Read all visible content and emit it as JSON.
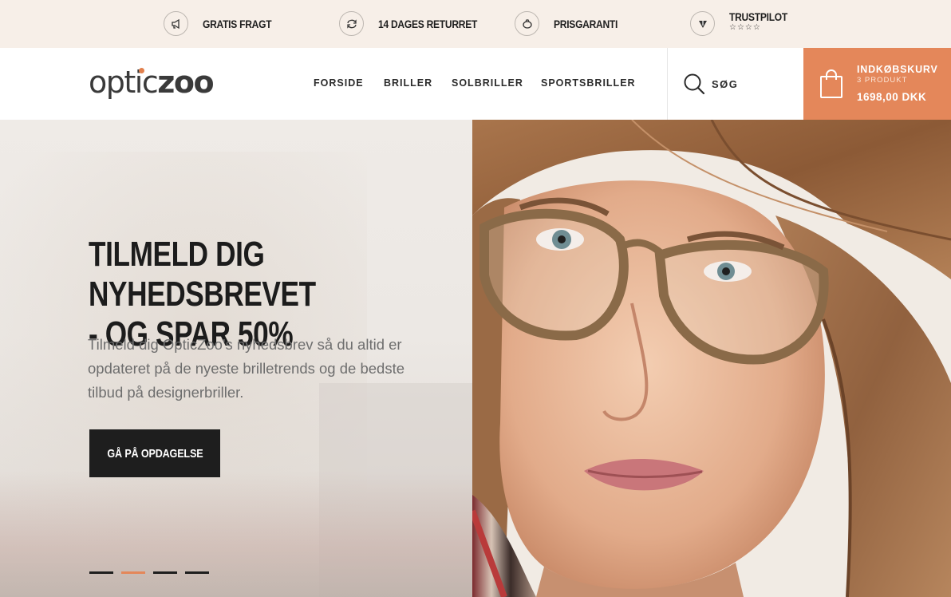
{
  "usp_bar": {
    "items": [
      {
        "icon": "megaphone-icon",
        "label": "GRATIS FRAGT"
      },
      {
        "icon": "exchange-icon",
        "label": "14 DAGES RETURRET"
      },
      {
        "icon": "piggy-bank-icon",
        "label": "PRISGARANTI"
      },
      {
        "icon": "trustpilot-icon",
        "label": "TRUSTPILOT",
        "rating_stars": "☆☆☆☆"
      }
    ]
  },
  "header": {
    "logo": {
      "part1": "optic",
      "part2": "zoo",
      "dot_color": "#e2804d"
    },
    "nav": [
      "FORSIDE",
      "BRILLER",
      "SOLBRILLER",
      "SPORTSBRILLER"
    ],
    "search_label": "SØG",
    "cart": {
      "title": "INDKØBSKURV",
      "count": "3 PRODUKT",
      "total": "1698,00 DKK",
      "color": "#e4875a"
    }
  },
  "hero": {
    "title_line1": "TILMELD DIG NYHEDSBREVET",
    "title_line2": "- OG SPAR 50%",
    "text": "Tilmeld dig OpticZoo's nyhedsbrev så du altid er opdateret på de nyeste brilletrends og de bedste tilbud på designerbriller.",
    "cta_label": "GÅ PÅ OPDAGELSE",
    "slides": {
      "count": 4,
      "active_index": 1
    }
  }
}
